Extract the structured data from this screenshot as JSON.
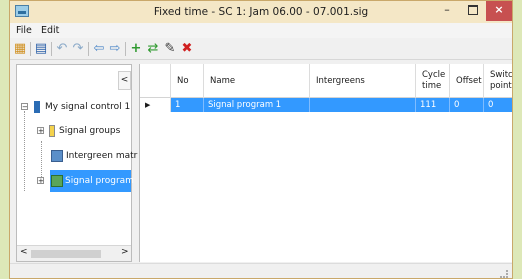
{
  "window": {
    "title": "Fixed time - SC 1: Jam 06.00 - 07.001.sig",
    "minimize": "–",
    "close": "×"
  },
  "menu": [
    "File",
    "Edit"
  ],
  "colors": {
    "selection": "#3399ff",
    "title_bar": "#f4e7c6",
    "close_button": "#c75050"
  },
  "toolbar": [
    {
      "name": "save-all-icon",
      "glyph": "▦"
    },
    {
      "name": "save-icon",
      "glyph": "▤"
    },
    {
      "name": "undo-icon",
      "glyph": "↶"
    },
    {
      "name": "redo-icon",
      "glyph": "↷"
    },
    {
      "name": "back-icon",
      "glyph": "⇦"
    },
    {
      "name": "forward-icon",
      "glyph": "⇨"
    },
    {
      "name": "add-icon",
      "glyph": "+"
    },
    {
      "name": "duplicate-icon",
      "glyph": "⇄"
    },
    {
      "name": "edit-icon",
      "glyph": "✎"
    },
    {
      "name": "delete-icon",
      "glyph": "✖"
    }
  ],
  "nav": {
    "collapse": "<",
    "tree": [
      {
        "label": "My signal control 1",
        "expander": "−",
        "icon": "signal-control-icon"
      },
      {
        "label": "Signal groups",
        "expander": "+",
        "icon": "signal-groups-icon"
      },
      {
        "label": "Intergreen matr",
        "expander": "",
        "icon": "intergreen-matrix-icon"
      },
      {
        "label": "Signal program",
        "expander": "+",
        "icon": "signal-program-icon",
        "selected": true
      }
    ],
    "scroll_left": "<",
    "scroll_right": ">"
  },
  "grid": {
    "headers": {
      "no": "No",
      "name": "Name",
      "intergreens": "Intergreens",
      "cycle_time": "Cycle time",
      "offset": "Offset",
      "switch_point": "Switch point"
    },
    "rows": [
      {
        "marker": "▶",
        "no": "1",
        "name": "Signal program 1",
        "intergreens": "",
        "cycle_time": "111",
        "offset": "0",
        "switch_point": "0"
      }
    ]
  }
}
